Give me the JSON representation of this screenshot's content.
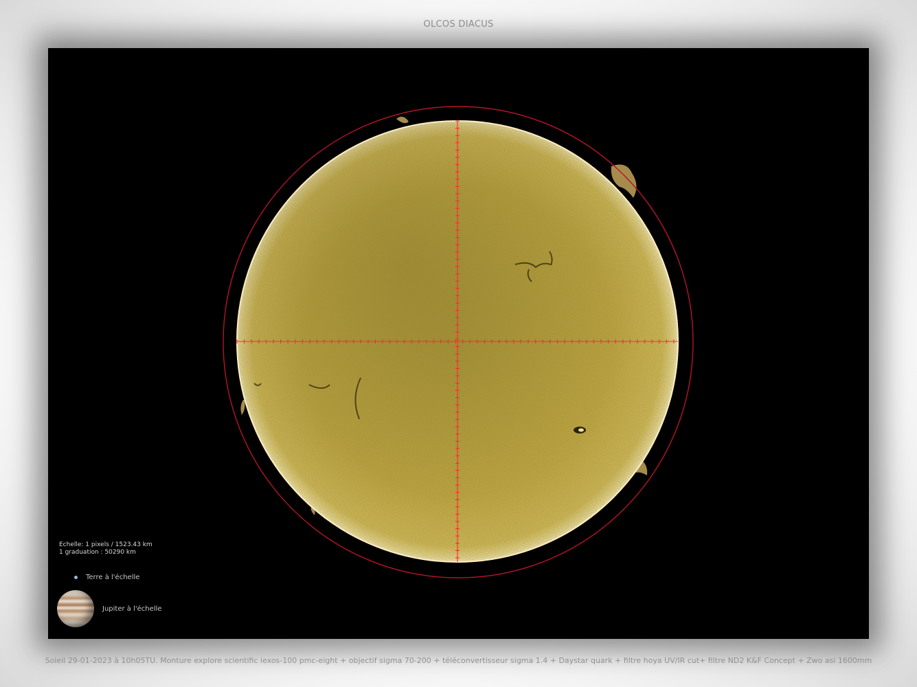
{
  "header": {
    "title": "OLCOS DIACUS"
  },
  "photo": {
    "subject": "Soleil",
    "colors": {
      "background": "#000000",
      "disk_light": "#d8bf5a",
      "disk_dark": "#7a6a22",
      "limb_ring": "#c0182a",
      "crosshair": "#ff2a2a"
    },
    "overlay": {
      "scale_line_1": "Echelle: 1 pixels / 1523.43 km",
      "scale_line_2": "1 graduation : 50290 km",
      "earth_label": "Terre à l'échelle",
      "jupiter_label": "Jupiter à l'échelle"
    }
  },
  "caption": "Soleil     29-01-2023  à  10h05TU. Monture explore scientific iexos-100 pmc-eight + objectif sigma  70-200 + téléconvertisseur sigma 1.4 + Daystar quark + filtre hoya UV/IR cut+ filtre ND2 K&F Concept + Zwo asi 1600mm"
}
